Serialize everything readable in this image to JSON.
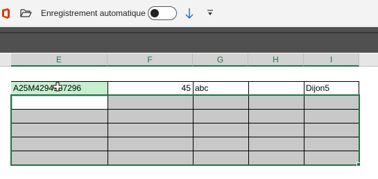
{
  "titlebar": {
    "autosave_label": "Enregistrement automatique",
    "autosave_state": "off",
    "icons": [
      "office-logo-icon",
      "folder-open-icon",
      "sort-down-icon",
      "customize-toolbar-icon"
    ]
  },
  "columns": [
    "E",
    "F",
    "G",
    "H",
    "I"
  ],
  "rows": [
    {
      "E": "A25M4294967296",
      "F": "45",
      "G": "abc",
      "H": "",
      "I": "Dijon5"
    }
  ],
  "colors": {
    "accent": "#217346",
    "active_cell": "#c6efce",
    "selection_fill": "#c8c8c8",
    "ribbon": "#505050"
  }
}
